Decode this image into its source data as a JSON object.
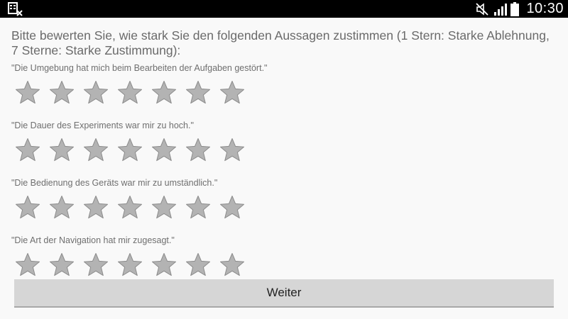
{
  "status_bar": {
    "time": "10:30",
    "icons": [
      "notification-app-icon",
      "mute-icon",
      "signal-icon",
      "battery-icon"
    ]
  },
  "survey": {
    "instructions": "Bitte bewerten Sie, wie stark Sie den folgenden Aussagen zustimmen (1 Stern: Starke Ablehnung, 7 Sterne: Starke Zustimmung):",
    "max_stars": 7,
    "questions": [
      {
        "statement": "\"Die Umgebung hat mich beim Bearbeiten der Aufgaben gestört.\"",
        "rating": 0
      },
      {
        "statement": "\"Die Dauer des Experiments war mir zu hoch.\"",
        "rating": 0
      },
      {
        "statement": "\"Die Bedienung des Geräts war mir zu umständlich.\"",
        "rating": 0
      },
      {
        "statement": "\"Die Art der Navigation hat mir zugesagt.\"",
        "rating": 0
      }
    ],
    "star_color": "#b3b3b3",
    "star_stroke": "#8c8c8c",
    "next_label": "Weiter"
  }
}
